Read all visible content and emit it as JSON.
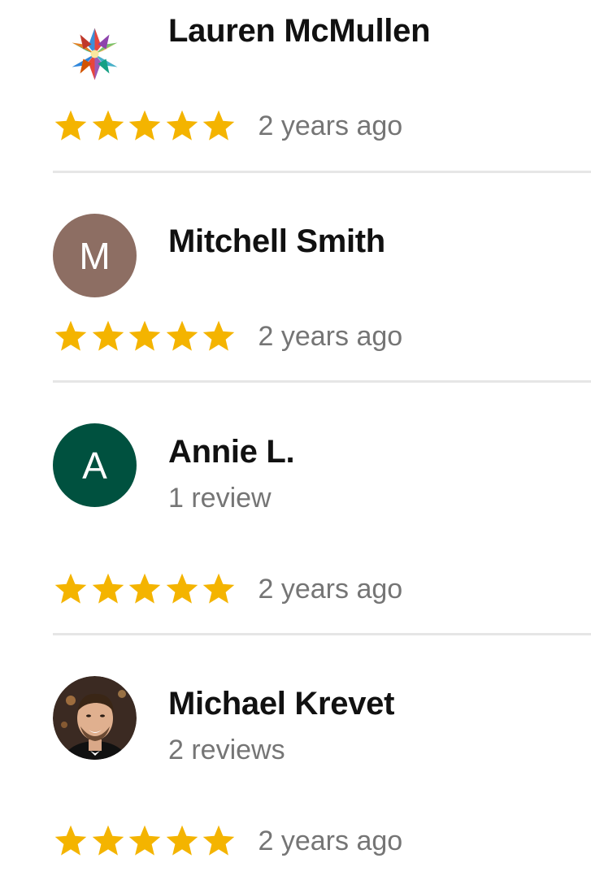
{
  "reviews": [
    {
      "name": "Lauren McMullen",
      "avatar": {
        "type": "image",
        "icon": "kaleidoscope-avatar-icon"
      },
      "review_count": "",
      "rating": 5,
      "time": "2 years ago"
    },
    {
      "name": "Mitchell Smith",
      "avatar": {
        "type": "initial",
        "initial": "M",
        "color": "#8d6e63"
      },
      "review_count": "",
      "rating": 5,
      "time": "2 years ago"
    },
    {
      "name": "Annie L.",
      "avatar": {
        "type": "initial",
        "initial": "A",
        "color": "#00513f"
      },
      "review_count": "1 review",
      "rating": 5,
      "time": "2 years ago"
    },
    {
      "name": "Michael Krevet",
      "avatar": {
        "type": "image",
        "icon": "person-photo-avatar-icon"
      },
      "review_count": "2 reviews",
      "rating": 5,
      "time": "2 years ago"
    }
  ],
  "colors": {
    "star": "#f4b400",
    "meta_text": "#757575",
    "divider": "#e6e6e6"
  }
}
